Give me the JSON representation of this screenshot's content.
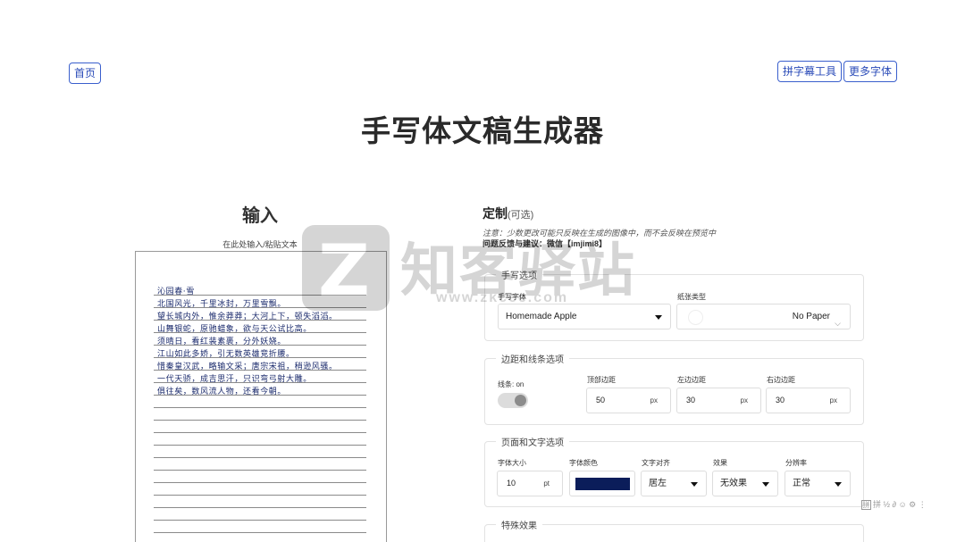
{
  "nav": {
    "home": "首页",
    "subtitle_tool": "拼字幕工具",
    "more_fonts": "更多字体"
  },
  "title": "手写体文稿生成器",
  "input": {
    "heading": "输入",
    "hint": "在此处输入/粘贴文本",
    "lines": [
      "沁园春·雪",
      "北国风光，千里冰封，万里雪飘。",
      "望长城内外，惟余莽莽；大河上下，顿失滔滔。",
      "山舞银蛇，原驰蜡象，欲与天公试比高。",
      "须晴日，看红装素裹，分外妖娆。",
      "江山如此多娇，引无数英雄竞折腰。",
      "惜秦皇汉武，略输文采；唐宗宋祖，稍逊风骚。",
      "一代天骄，成吉思汗，只识弯弓射大雕。",
      "俱往矣，数风流人物，还看今朝。"
    ]
  },
  "custom": {
    "heading": "定制",
    "optional": "(可选)",
    "note": "注意：少数更改可能只反映在生成的图像中，而不会反映在预览中",
    "feedback": "问题反馈与建议：微信【imjimi8】"
  },
  "handwriting": {
    "legend": "手写选项",
    "font_label": "手写字体",
    "font_value": "Homemade Apple",
    "paper_label": "纸张类型",
    "paper_value": "No Paper"
  },
  "margins": {
    "legend": "边距和线条选项",
    "lines_label": "线条: on",
    "lines_on": true,
    "top_label": "顶部边距",
    "top_value": "50",
    "left_label": "左边边距",
    "left_value": "30",
    "right_label": "右边边距",
    "right_value": "30",
    "unit": "px"
  },
  "page": {
    "legend": "页面和文字选项",
    "size_label": "字体大小",
    "size_value": "10",
    "size_unit": "pt",
    "color_label": "字体颜色",
    "color_value": "#0b1d5a",
    "align_label": "文字对齐",
    "align_value": "居左",
    "effect_label": "效果",
    "effect_value": "无效果",
    "resolution_label": "分辨率",
    "resolution_value": "正常"
  },
  "effects": {
    "legend": "特殊效果"
  },
  "watermark": {
    "brand": "知客驿站",
    "url": "www.zkcee.com"
  },
  "toolstrip": {
    "text": "拼 ½ ∂ ☺ ⚙ ⋮"
  }
}
